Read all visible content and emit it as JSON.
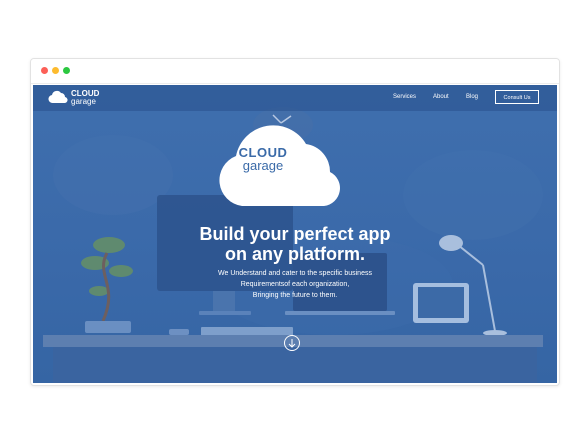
{
  "nav": {
    "logo_line1": "CLOUD",
    "logo_line2": "garage",
    "links": [
      "Services",
      "About",
      "Blog"
    ],
    "cta": "Consult Us"
  },
  "hero": {
    "logo_line1": "CLOUD",
    "logo_line2": "garage",
    "headline_line1": "Build your perfect app",
    "headline_line2": "on any platform.",
    "sub_line1": "We Understand and cater to the specific business",
    "sub_line2": "Requirementsof each organization,",
    "sub_line3": "Bringing the future to them."
  },
  "colors": {
    "overlay": "#3a69a9",
    "logo_text": "#3a6aa8",
    "white": "#ffffff"
  },
  "icons": {
    "logo": "cloud-icon",
    "scroll": "arrow-down-circle-icon"
  }
}
